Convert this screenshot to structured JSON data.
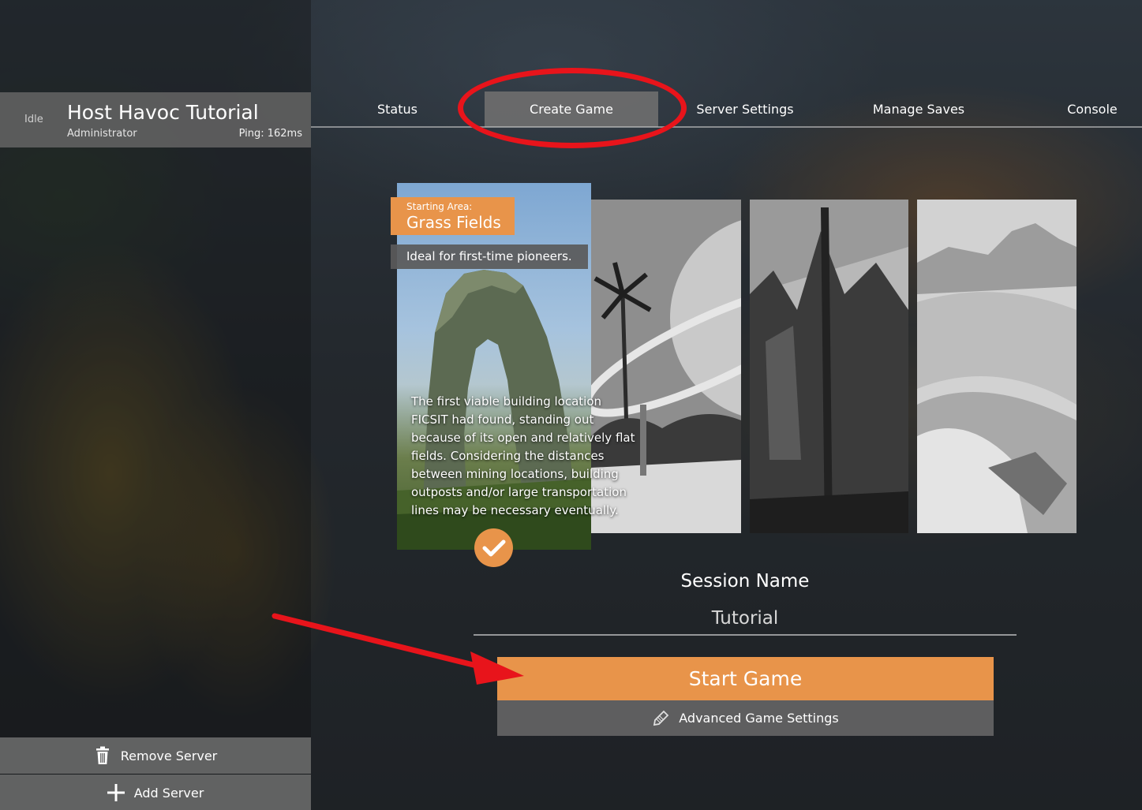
{
  "server": {
    "status": "Idle",
    "name": "Host Havoc Tutorial",
    "role": "Administrator",
    "ping": "Ping: 162ms"
  },
  "sidebar": {
    "remove_label": "Remove Server",
    "add_label": "Add Server"
  },
  "nav": {
    "tabs": [
      {
        "label": "Status"
      },
      {
        "label": "Create Game"
      },
      {
        "label": "Server Settings"
      },
      {
        "label": "Manage Saves"
      },
      {
        "label": "Console"
      }
    ],
    "active": "Create Game"
  },
  "starting_area": {
    "caption": "Starting Area:",
    "name": "Grass Fields",
    "tagline": "Ideal for first-time pioneers.",
    "description": "The first viable building location FICSIT had found, standing out because of its open and relatively flat fields. Considering the distances between mining locations, building outposts and/or large transportation lines may be necessary eventually."
  },
  "session": {
    "title": "Session Name",
    "value": "Tutorial"
  },
  "buttons": {
    "start": "Start Game",
    "advanced": "Advanced Game Settings"
  },
  "colors": {
    "accent": "#e8944a",
    "annotation": "#e8141b"
  }
}
